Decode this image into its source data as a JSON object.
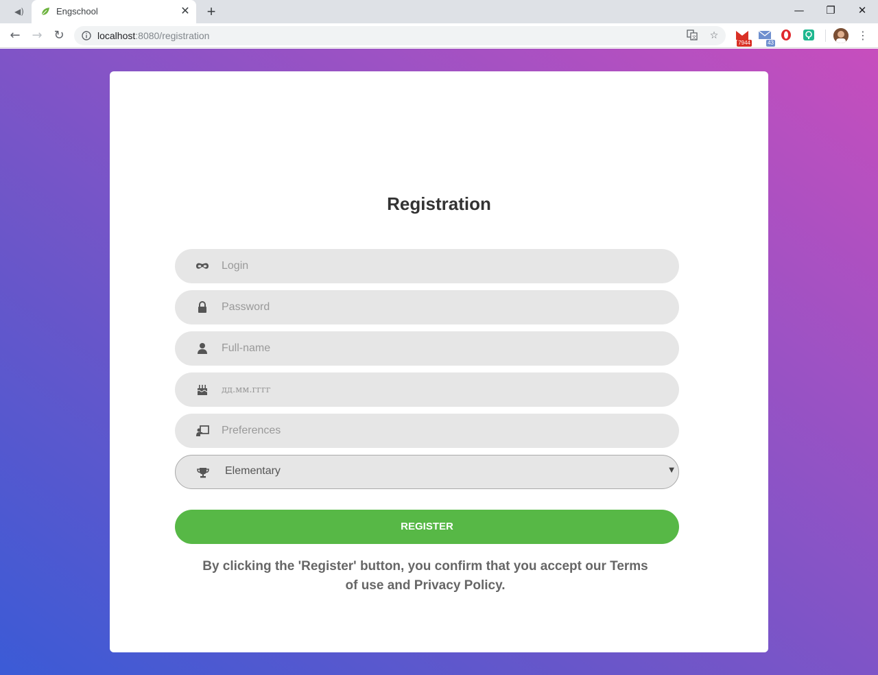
{
  "browser": {
    "tab_title": "Engschool",
    "url_host": "localhost",
    "url_rest": ":8080/registration",
    "extensions": {
      "gmail_badge": "7944",
      "mail_badge": "43"
    }
  },
  "form": {
    "title": "Registration",
    "fields": {
      "login_placeholder": "Login",
      "password_placeholder": "Password",
      "fullname_placeholder": "Full-name",
      "birthdate_placeholder": "дд.мм.гггг",
      "preferences_placeholder": "Preferences"
    },
    "level_select": {
      "selected": "Elementary"
    },
    "register_label": "REGISTER",
    "terms_text": "By clicking the 'Register' button, you confirm that you accept our Terms of use and Privacy Policy."
  },
  "colors": {
    "register_button": "#57b846",
    "gradient_start": "#3b5bd6",
    "gradient_end": "#c74ebd"
  },
  "icons": [
    "speaker-icon",
    "leaf-favicon-icon",
    "close-icon",
    "plus-icon",
    "minimize-icon",
    "restore-icon",
    "window-close-icon",
    "back-arrow-icon",
    "forward-arrow-icon",
    "reload-icon",
    "info-icon",
    "translate-icon",
    "star-icon",
    "gmail-icon",
    "mail-icon",
    "opera-icon",
    "extension-icon",
    "avatar",
    "menu-dots-icon",
    "mask-icon",
    "lock-icon",
    "user-icon",
    "cake-icon",
    "chalkboard-icon",
    "trophy-icon"
  ]
}
